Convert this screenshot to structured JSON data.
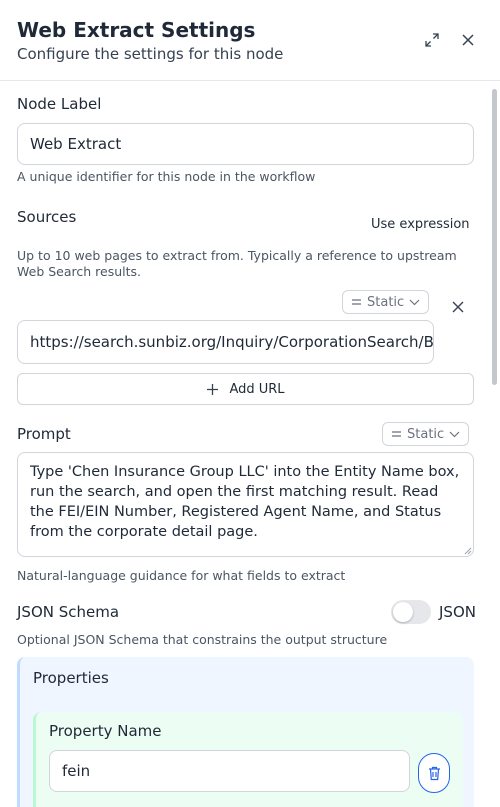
{
  "header": {
    "title": "Web Extract Settings",
    "subtitle": "Configure the settings for this node"
  },
  "node_label": {
    "label": "Node Label",
    "value": "Web Extract",
    "help": "A unique identifier for this node in the workflow"
  },
  "sources": {
    "label": "Sources",
    "use_expression": "Use expression",
    "help": "Up to 10 web pages to extract from. Typically a reference to upstream Web Search results.",
    "mode": "Static",
    "urls": [
      "https://search.sunbiz.org/Inquiry/CorporationSearch/ByName"
    ],
    "add_url_label": "Add URL"
  },
  "prompt": {
    "label": "Prompt",
    "mode": "Static",
    "value": "Type 'Chen Insurance Group LLC' into the Entity Name box, run the search, and open the first matching result. Read the FEI/EIN Number, Registered Agent Name, and Status from the corporate detail page.",
    "help": "Natural-language guidance for what fields to extract"
  },
  "json_schema": {
    "label": "JSON Schema",
    "toggle_label": "JSON",
    "toggle_on": false,
    "help": "Optional JSON Schema that constrains the output structure",
    "properties_label": "Properties",
    "property_name_label": "Property Name",
    "property_name_value": "fein"
  },
  "icons": {
    "expand": "expand-icon",
    "close": "close-icon",
    "remove_url": "close-icon",
    "add": "plus-icon",
    "mode": "equals-icon",
    "dropdown": "chevron-down-icon",
    "delete": "trash-icon"
  },
  "colors": {
    "accent": "#2563eb",
    "properties_bg": "#eff6ff",
    "property_bg": "#ecfdf3"
  }
}
